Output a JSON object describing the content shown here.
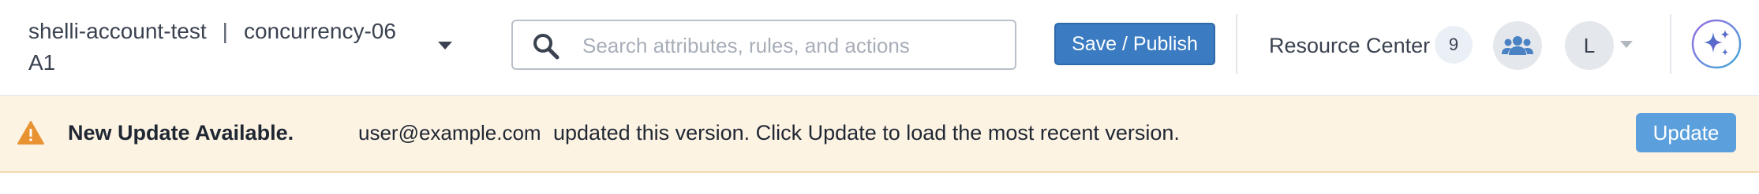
{
  "account": {
    "name": "shelli-account-test",
    "separator": "|",
    "project": "concurrency-06",
    "project_suffix": "A1"
  },
  "search": {
    "placeholder": "Search attributes, rules, and actions",
    "value": "",
    "icon": "search-icon"
  },
  "toolbar": {
    "save_label": "Save / Publish",
    "resource_center_label": "Resource Center",
    "resource_center_count": "9",
    "team_icon": "people-icon",
    "avatar_initial": "L",
    "ai_icon": "sparkle-icon"
  },
  "banner": {
    "title": "New Update Available.",
    "email": "user@example.com",
    "message": "updated this version. Click Update to load the most recent version.",
    "update_label": "Update",
    "icon": "warning-icon"
  },
  "colors": {
    "primary_button": "#3a7bc1",
    "banner_background": "#fdf3e3",
    "warning": "#e89232",
    "update_button": "#5b9fdc"
  }
}
